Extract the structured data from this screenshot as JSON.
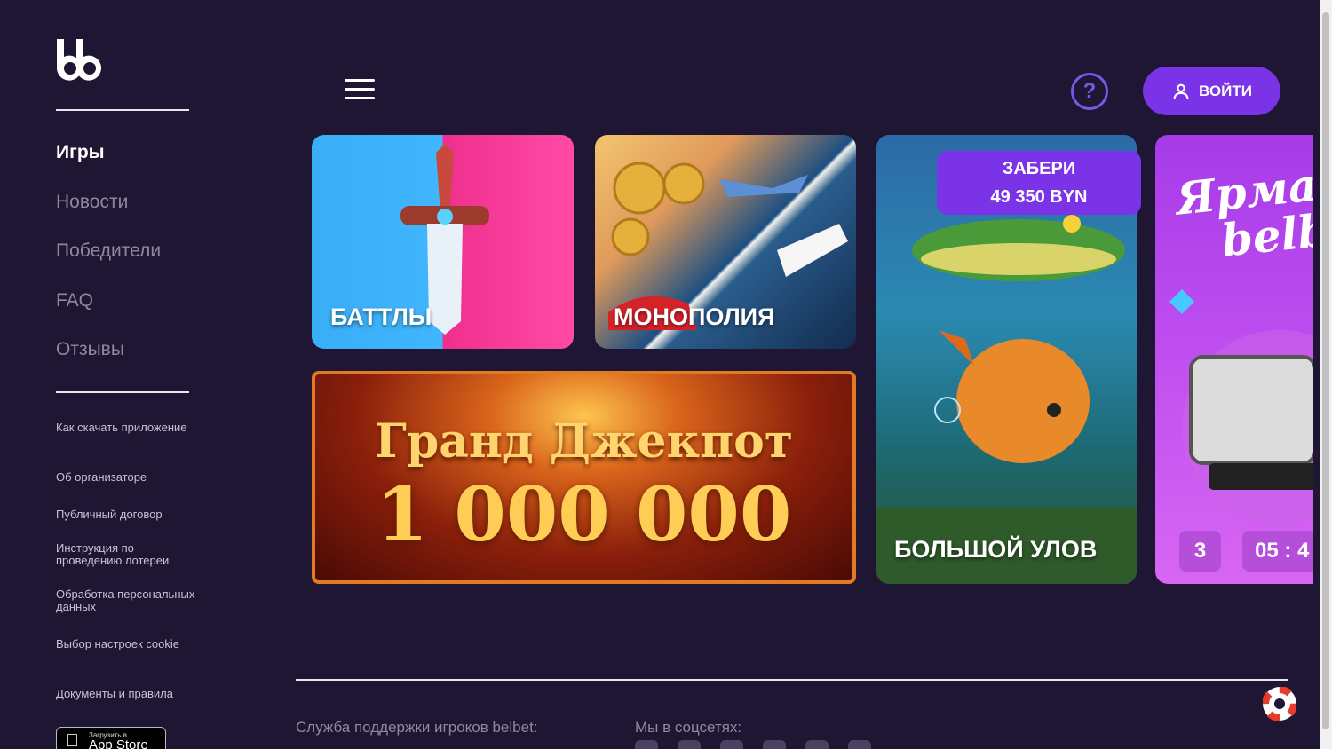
{
  "sidebar": {
    "nav": [
      {
        "label": "Игры"
      },
      {
        "label": "Новости"
      },
      {
        "label": "Победители"
      },
      {
        "label": "FAQ"
      },
      {
        "label": "Отзывы"
      }
    ],
    "links": [
      {
        "label": "Как скачать приложение"
      },
      {
        "label": "Об организаторе"
      },
      {
        "label": "Публичный договор"
      },
      {
        "label": "Инструкция по проведению лотереи"
      },
      {
        "label": "Обработка персональных данных"
      },
      {
        "label": "Выбор настроек cookie"
      },
      {
        "label": "Документы и правила"
      }
    ],
    "appstore": {
      "small": "Загрузить в",
      "big": "App Store"
    }
  },
  "header": {
    "help_label": "?",
    "login_label": "ВОЙТИ"
  },
  "cards": {
    "battles": {
      "title": "БАТТЛЫ"
    },
    "monopoly": {
      "title": "МОНОПОЛИЯ"
    },
    "jackpot": {
      "line1": "Гранд Джекпот",
      "line2": "1 000 000"
    },
    "fishing": {
      "title": "БОЛЬШОЙ УЛОВ",
      "badge_line1": "ЗАБЕРИ",
      "badge_line2": "49 350 BYN"
    },
    "fair": {
      "title_line1": "Ярма",
      "title_line2": "belb",
      "count": "3",
      "timer": "05 : 4"
    }
  },
  "footer": {
    "support_label": "Служба поддержки игроков belbet:",
    "social_label": "Мы в соцсетях:"
  },
  "colors": {
    "background": "#1f1633",
    "accent": "#7a33e6"
  }
}
